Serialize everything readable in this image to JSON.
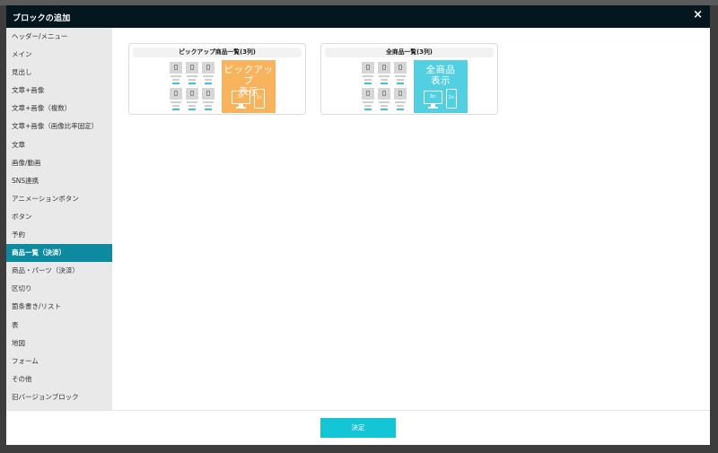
{
  "modal": {
    "title": "ブロックの追加",
    "close_glyph": "×"
  },
  "sidebar": {
    "items": [
      {
        "label": "ヘッダー/メニュー"
      },
      {
        "label": "メイン"
      },
      {
        "label": "見出し"
      },
      {
        "label": "文章+画像"
      },
      {
        "label": "文章+画像（複数）"
      },
      {
        "label": "文章+画像（画像比率固定）"
      },
      {
        "label": "文章"
      },
      {
        "label": "画像/動画"
      },
      {
        "label": "SNS連携"
      },
      {
        "label": "アニメーションボタン"
      },
      {
        "label": "ボタン"
      },
      {
        "label": "予約"
      },
      {
        "label": "商品一覧（決済）",
        "active": true
      },
      {
        "label": "商品・パーツ（決済）"
      },
      {
        "label": "区切り"
      },
      {
        "label": "箇条書き/リスト"
      },
      {
        "label": "表"
      },
      {
        "label": "地図"
      },
      {
        "label": "フォーム"
      },
      {
        "label": "その他"
      },
      {
        "label": "旧バージョンブロック"
      }
    ]
  },
  "cards": [
    {
      "title": "ピックアップ商品一覧(3列)",
      "promo_line1": "ピックアップ",
      "promo_line2": "表示",
      "monitor_label": "3n",
      "phone_label": "2n",
      "color": "#f9b35c"
    },
    {
      "title": "全商品一覧(3列)",
      "promo_line1": "全商品",
      "promo_line2": "表示",
      "monitor_label": "3n",
      "phone_label": "2n",
      "color": "#52cfe0"
    }
  ],
  "footer": {
    "submit_label": "決定"
  },
  "colors": {
    "header_bg": "#04171f",
    "active_item": "#0e8aa0",
    "submit": "#14c5d6"
  }
}
